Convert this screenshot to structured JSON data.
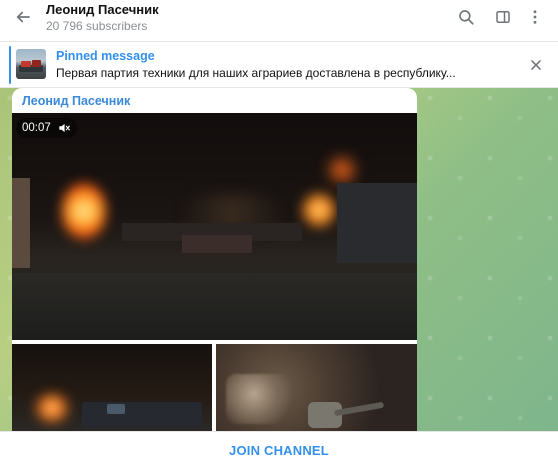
{
  "header": {
    "title": "Леонид Пасечник",
    "subtitle": "20 796 subscribers"
  },
  "pinned": {
    "title": "Pinned message",
    "text": "Первая партия техники для наших аграриев доставлена в республику..."
  },
  "message": {
    "author": "Леонид Пасечник",
    "video_duration": "00:07"
  },
  "footer": {
    "join_label": "JOIN CHANNEL"
  },
  "colors": {
    "accent": "#3390ec",
    "author": "#3a8ad9",
    "icon": "#707579"
  },
  "icons": {
    "back": "arrow-left-icon",
    "search": "search-icon",
    "sidebar": "sidebar-icon",
    "more": "more-vertical-icon",
    "close": "close-icon",
    "mute": "muted-speaker-icon"
  }
}
